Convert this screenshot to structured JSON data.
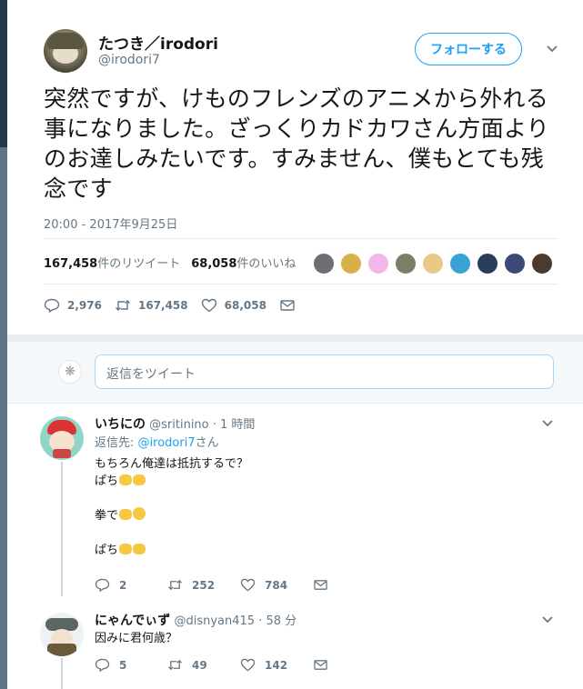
{
  "tweet": {
    "author_name": "たつき／irodori",
    "author_handle": "@irodori7",
    "follow_label": "フォローする",
    "text": "突然ですが、けものフレンズのアニメから外れる事になりました。ざっくりカドカワさん方面よりのお達しみたいです。すみません、僕もとても残念です",
    "timestamp": "20:00 - 2017年9月25日",
    "retweet_count": "167,458",
    "retweet_suffix": "件のリツイート",
    "like_count": "68,058",
    "like_suffix": "件のいいね",
    "likers": [
      "#6d6f74",
      "#d8b04a",
      "#f2b6e8",
      "#7a8068",
      "#e8c98a",
      "#3aa3d6",
      "#2a3d5c",
      "#3c4a7a",
      "#4b3b2e"
    ],
    "actions": {
      "replies": "2,976",
      "retweets": "167,458",
      "likes": "68,058"
    }
  },
  "reply_box": {
    "placeholder": "返信をツイート"
  },
  "replies": [
    {
      "name": "いちにの",
      "handle": "@sritinino",
      "time": "· 1 時間",
      "reply_to_prefix": "返信先:",
      "reply_to_handle": "@irodori7",
      "reply_to_suffix": "さん",
      "lines": [
        "もちろん俺達は抵抗するで？",
        "ぱち",
        "",
        "拳で",
        "",
        "ぱち"
      ],
      "actions": {
        "replies": "2",
        "retweets": "252",
        "likes": "784"
      }
    },
    {
      "name": "にゃんでぃず",
      "handle": "@disnyan415",
      "time": "· 58 分",
      "lines": [
        "因みに君何歳？"
      ],
      "actions": {
        "replies": "5",
        "retweets": "49",
        "likes": "142"
      }
    }
  ]
}
